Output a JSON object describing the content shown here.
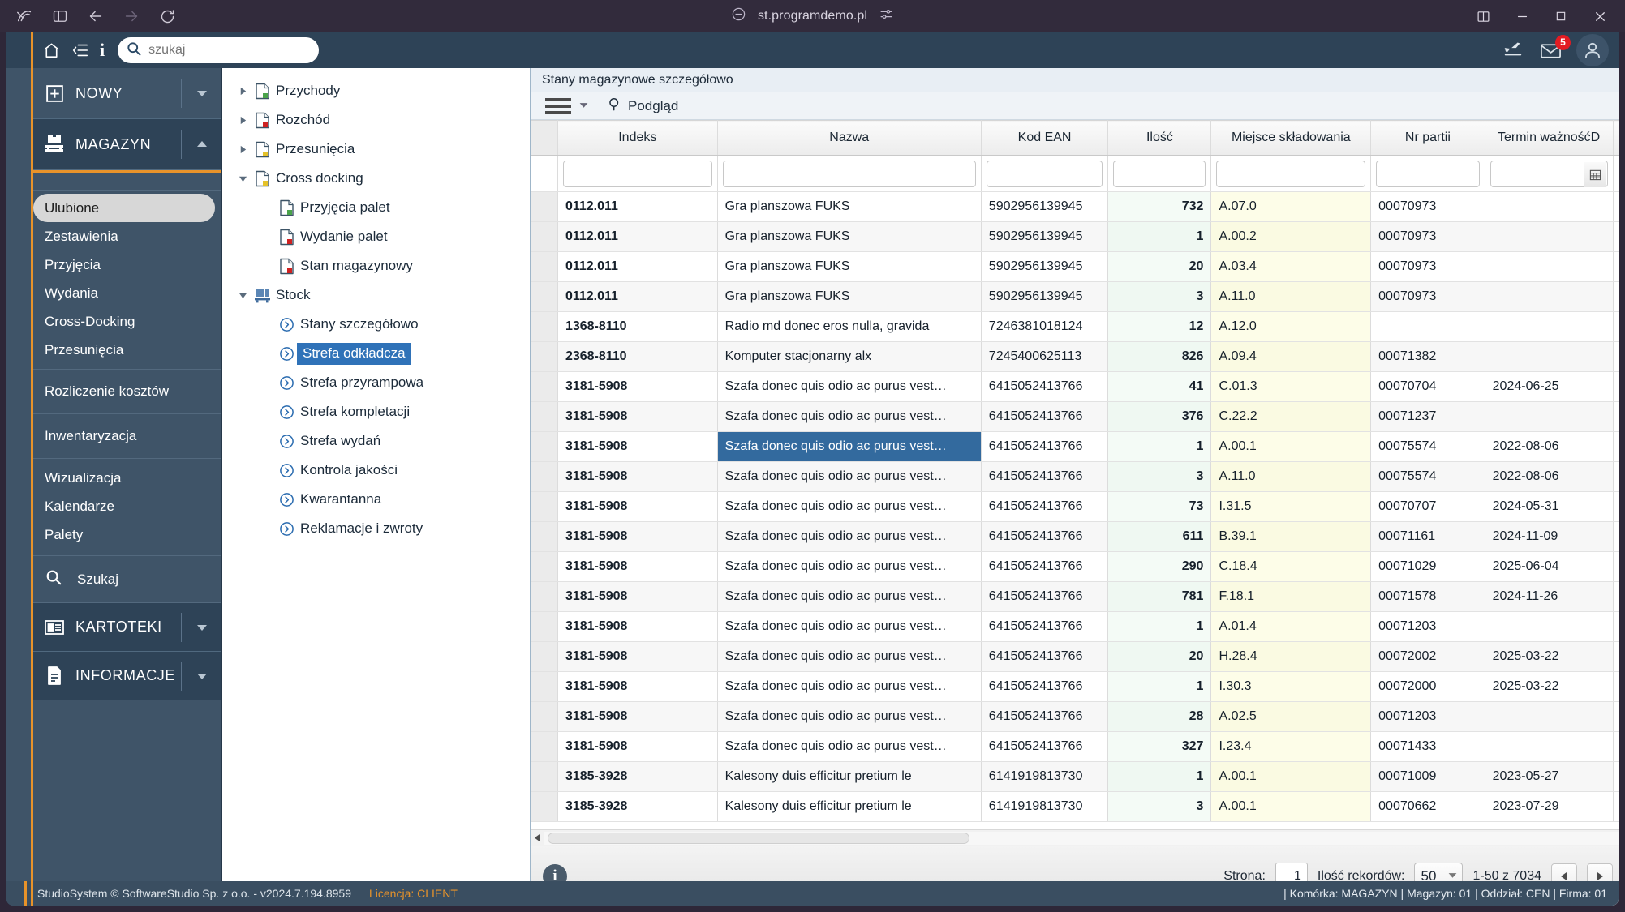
{
  "browser": {
    "url": "st.programdemo.pl",
    "nav": {
      "back_label": "Back",
      "forward_label": "Forward",
      "reload_label": "Reload",
      "sidebar_label": "Toggle sidebar",
      "arc_label": "Browser logo"
    },
    "window": {
      "split_label": "Split view",
      "minimize_label": "Minimize",
      "maximize_label": "Maximize",
      "close_label": "Close"
    }
  },
  "topbar": {
    "search_placeholder": "szukaj",
    "search_value": "",
    "mail_badge": "5"
  },
  "sidebar": {
    "sections": [
      {
        "label": "NOWY",
        "icon": "plus-box-icon",
        "expanded": false
      },
      {
        "label": "MAGAZYN",
        "icon": "pallet-icon",
        "expanded": true
      }
    ],
    "menu_group_1": [
      {
        "label": "Ulubione",
        "active": true
      },
      {
        "label": "Zestawienia",
        "active": false
      },
      {
        "label": "Przyjęcia",
        "active": false
      },
      {
        "label": "Wydania",
        "active": false
      },
      {
        "label": "Cross-Docking",
        "active": false
      },
      {
        "label": "Przesunięcia",
        "active": false
      }
    ],
    "menu_group_2": [
      {
        "label": "Rozliczenie kosztów"
      }
    ],
    "menu_group_3": [
      {
        "label": "Inwentaryzacja"
      }
    ],
    "menu_group_4": [
      {
        "label": "Wizualizacja"
      },
      {
        "label": "Kalendarze"
      },
      {
        "label": "Palety"
      }
    ],
    "search_item": {
      "label": "Szukaj",
      "icon": "search-icon"
    },
    "bottom_sections": [
      {
        "label": "KARTOTEKI",
        "icon": "cards-icon"
      },
      {
        "label": "INFORMACJE",
        "icon": "document-icon"
      }
    ]
  },
  "tree": [
    {
      "label": "Przychody",
      "level": 0,
      "arrow": "collapsed",
      "icon": "doc-green-icon",
      "selected": false
    },
    {
      "label": "Rozchód",
      "level": 0,
      "arrow": "collapsed",
      "icon": "doc-red-icon",
      "selected": false
    },
    {
      "label": "Przesunięcia",
      "level": 0,
      "arrow": "collapsed",
      "icon": "doc-yellow-icon",
      "selected": false
    },
    {
      "label": "Cross docking",
      "level": 0,
      "arrow": "expanded",
      "icon": "doc-yellow-icon",
      "selected": false
    },
    {
      "label": "Przyjęcia palet",
      "level": 1,
      "arrow": "none",
      "icon": "doc-green-icon",
      "selected": false
    },
    {
      "label": "Wydanie palet",
      "level": 1,
      "arrow": "none",
      "icon": "doc-red-icon",
      "selected": false
    },
    {
      "label": "Stan magazynowy",
      "level": 1,
      "arrow": "none",
      "icon": "doc-red-icon",
      "selected": false
    },
    {
      "label": "Stock",
      "level": 0,
      "arrow": "expanded",
      "icon": "stock-icon",
      "selected": false
    },
    {
      "label": "Stany szczegółowo",
      "level": 1,
      "arrow": "none",
      "icon": "chevron-circle-icon",
      "selected": false
    },
    {
      "label": "Strefa odkładcza",
      "level": 1,
      "arrow": "none",
      "icon": "chevron-circle-icon",
      "selected": true
    },
    {
      "label": "Strefa przyrampowa",
      "level": 1,
      "arrow": "none",
      "icon": "chevron-circle-icon",
      "selected": false
    },
    {
      "label": "Strefa kompletacji",
      "level": 1,
      "arrow": "none",
      "icon": "chevron-circle-icon",
      "selected": false
    },
    {
      "label": "Strefa wydań",
      "level": 1,
      "arrow": "none",
      "icon": "chevron-circle-icon",
      "selected": false
    },
    {
      "label": "Kontrola jakości",
      "level": 1,
      "arrow": "none",
      "icon": "chevron-circle-icon",
      "selected": false
    },
    {
      "label": "Kwarantanna",
      "level": 1,
      "arrow": "none",
      "icon": "chevron-circle-icon",
      "selected": false
    },
    {
      "label": "Reklamacje i zwroty",
      "level": 1,
      "arrow": "none",
      "icon": "chevron-circle-icon",
      "selected": false
    }
  ],
  "main": {
    "title": "Stany magazynowe szczegółowo",
    "toolbar": {
      "menu_label": "Menu",
      "preview_label": "Podgląd"
    },
    "columns": [
      "Indeks",
      "Nazwa",
      "Kod EAN",
      "Ilość",
      "Miejsce składowania",
      "Nr partii",
      "Termin ważnośćD"
    ],
    "filters": [
      "",
      "",
      "",
      "",
      "",
      "",
      ""
    ],
    "rows": [
      {
        "indeks": "0112.011",
        "nazwa": "Gra planszowa FUKS",
        "ean": "5902956139945",
        "ilosc": "732",
        "miejsce": "A.07.0",
        "partia": "00070973",
        "termin": ""
      },
      {
        "indeks": "0112.011",
        "nazwa": "Gra planszowa FUKS",
        "ean": "5902956139945",
        "ilosc": "1",
        "miejsce": "A.00.2",
        "partia": "00070973",
        "termin": ""
      },
      {
        "indeks": "0112.011",
        "nazwa": "Gra planszowa FUKS",
        "ean": "5902956139945",
        "ilosc": "20",
        "miejsce": "A.03.4",
        "partia": "00070973",
        "termin": ""
      },
      {
        "indeks": "0112.011",
        "nazwa": "Gra planszowa FUKS",
        "ean": "5902956139945",
        "ilosc": "3",
        "miejsce": "A.11.0",
        "partia": "00070973",
        "termin": ""
      },
      {
        "indeks": "1368-8110",
        "nazwa": "Radio md donec eros nulla, gravida",
        "ean": "7246381018124",
        "ilosc": "12",
        "miejsce": "A.12.0",
        "partia": "",
        "termin": ""
      },
      {
        "indeks": "2368-8110",
        "nazwa": "Komputer stacjonarny alx",
        "ean": "7245400625113",
        "ilosc": "826",
        "miejsce": "A.09.4",
        "partia": "00071382",
        "termin": ""
      },
      {
        "indeks": "3181-5908",
        "nazwa": "Szafa donec quis odio ac purus vest…",
        "ean": "6415052413766",
        "ilosc": "41",
        "miejsce": "C.01.3",
        "partia": "00070704",
        "termin": "2024-06-25"
      },
      {
        "indeks": "3181-5908",
        "nazwa": "Szafa donec quis odio ac purus vest…",
        "ean": "6415052413766",
        "ilosc": "376",
        "miejsce": "C.22.2",
        "partia": "00071237",
        "termin": ""
      },
      {
        "indeks": "3181-5908",
        "nazwa": "Szafa donec quis odio ac purus vest…",
        "ean": "6415052413766",
        "ilosc": "1",
        "miejsce": "A.00.1",
        "partia": "00075574",
        "termin": "2022-08-06",
        "selected_cell": "nazwa"
      },
      {
        "indeks": "3181-5908",
        "nazwa": "Szafa donec quis odio ac purus vest…",
        "ean": "6415052413766",
        "ilosc": "3",
        "miejsce": "A.11.0",
        "partia": "00075574",
        "termin": "2022-08-06"
      },
      {
        "indeks": "3181-5908",
        "nazwa": "Szafa donec quis odio ac purus vest…",
        "ean": "6415052413766",
        "ilosc": "73",
        "miejsce": "I.31.5",
        "partia": "00070707",
        "termin": "2024-05-31"
      },
      {
        "indeks": "3181-5908",
        "nazwa": "Szafa donec quis odio ac purus vest…",
        "ean": "6415052413766",
        "ilosc": "611",
        "miejsce": "B.39.1",
        "partia": "00071161",
        "termin": "2024-11-09"
      },
      {
        "indeks": "3181-5908",
        "nazwa": "Szafa donec quis odio ac purus vest…",
        "ean": "6415052413766",
        "ilosc": "290",
        "miejsce": "C.18.4",
        "partia": "00071029",
        "termin": "2025-06-04"
      },
      {
        "indeks": "3181-5908",
        "nazwa": "Szafa donec quis odio ac purus vest…",
        "ean": "6415052413766",
        "ilosc": "781",
        "miejsce": "F.18.1",
        "partia": "00071578",
        "termin": "2024-11-26"
      },
      {
        "indeks": "3181-5908",
        "nazwa": "Szafa donec quis odio ac purus vest…",
        "ean": "6415052413766",
        "ilosc": "1",
        "miejsce": "A.01.4",
        "partia": "00071203",
        "termin": ""
      },
      {
        "indeks": "3181-5908",
        "nazwa": "Szafa donec quis odio ac purus vest…",
        "ean": "6415052413766",
        "ilosc": "20",
        "miejsce": "H.28.4",
        "partia": "00072002",
        "termin": "2025-03-22"
      },
      {
        "indeks": "3181-5908",
        "nazwa": "Szafa donec quis odio ac purus vest…",
        "ean": "6415052413766",
        "ilosc": "1",
        "miejsce": "I.30.3",
        "partia": "00072000",
        "termin": "2025-03-22"
      },
      {
        "indeks": "3181-5908",
        "nazwa": "Szafa donec quis odio ac purus vest…",
        "ean": "6415052413766",
        "ilosc": "28",
        "miejsce": "A.02.5",
        "partia": "00071203",
        "termin": ""
      },
      {
        "indeks": "3181-5908",
        "nazwa": "Szafa donec quis odio ac purus vest…",
        "ean": "6415052413766",
        "ilosc": "327",
        "miejsce": "I.23.4",
        "partia": "00071433",
        "termin": ""
      },
      {
        "indeks": "3185-3928",
        "nazwa": "Kalesony duis efficitur pretium le",
        "ean": "6141919813730",
        "ilosc": "1",
        "miejsce": "A.00.1",
        "partia": "00071009",
        "termin": "2023-05-27"
      },
      {
        "indeks": "3185-3928",
        "nazwa": "Kalesony duis efficitur pretium le",
        "ean": "6141919813730",
        "ilosc": "3",
        "miejsce": "A.00.1",
        "partia": "00070662",
        "termin": "2023-07-29"
      }
    ],
    "pager": {
      "page_label": "Strona:",
      "page_value": "1",
      "records_label": "Ilość rekordów:",
      "records_value": "50",
      "range": "1-50 z 7034",
      "prev_label": "Poprzednia",
      "next_label": "Następna"
    }
  },
  "statusbar": {
    "copyright": "StudioSystem © SoftwareStudio Sp. z o.o. - v2024.7.194.8959",
    "license": "Licencja: CLIENT",
    "right": "| Komórka: MAGAZYN | Magazyn: 01 | Oddział: CEN | Firma: 01"
  },
  "colors": {
    "accent_orange": "#e8932a",
    "sidebar_bg": "#3f5468",
    "selection_blue": "#336a9e",
    "badge_red": "#e31b22"
  }
}
